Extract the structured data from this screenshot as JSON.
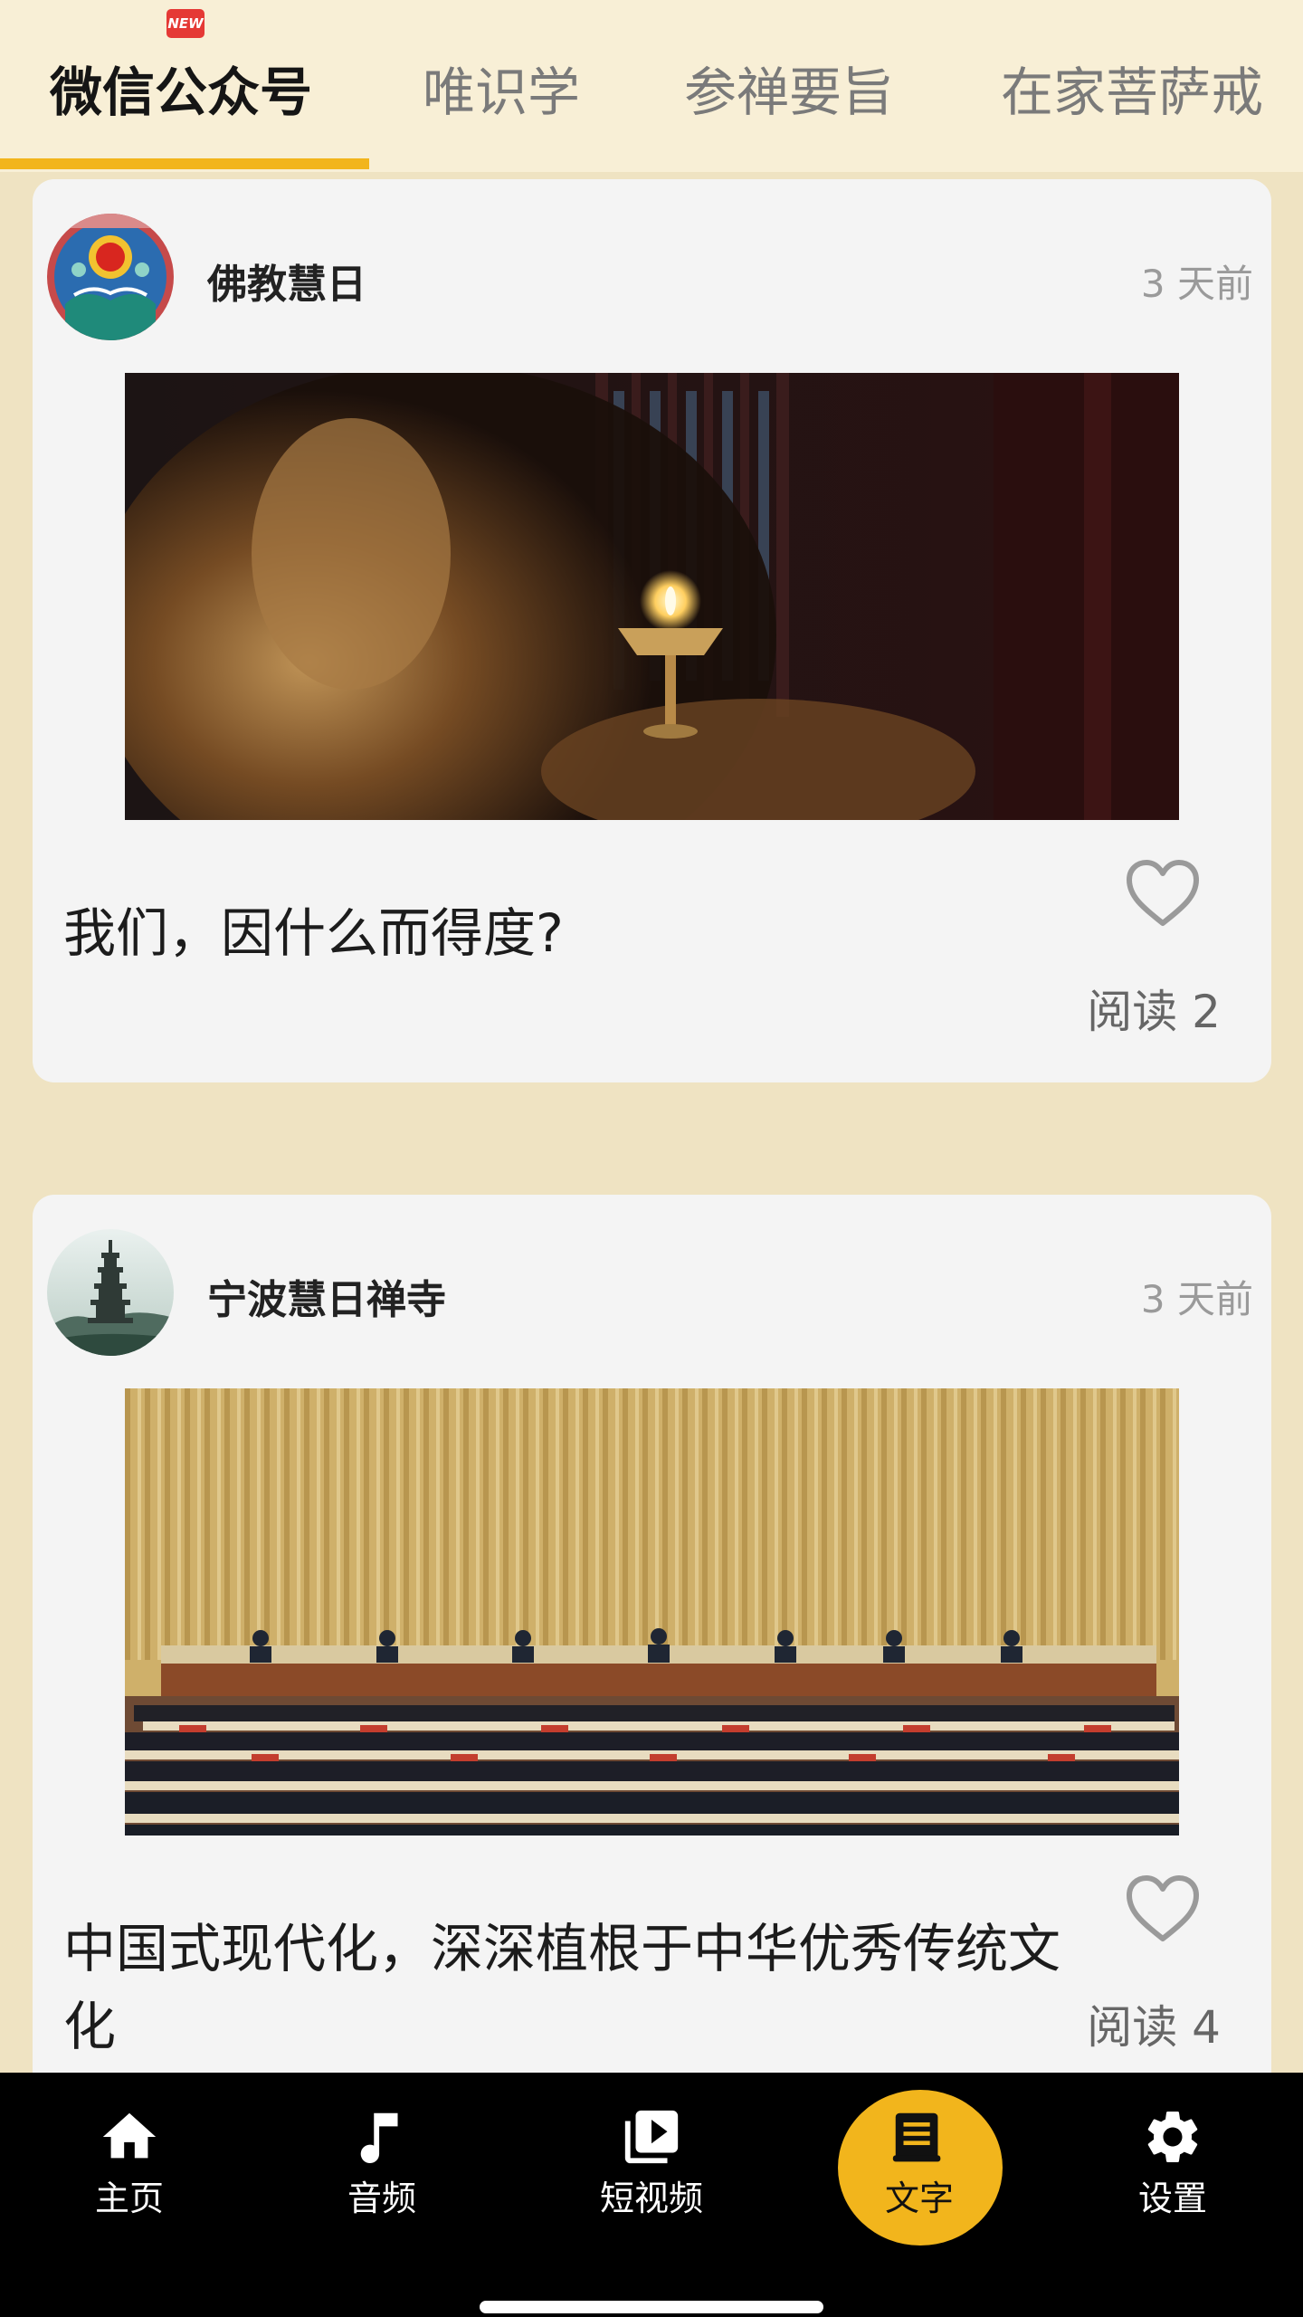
{
  "tabs": [
    {
      "label": "微信公众号",
      "active": true,
      "badge": "NEW"
    },
    {
      "label": "唯识学",
      "active": false
    },
    {
      "label": "参禅要旨",
      "active": false
    },
    {
      "label": "在家菩萨戒",
      "active": false
    }
  ],
  "posts": [
    {
      "author": "佛教慧日",
      "time": "3 天前",
      "title": "我们，因什么而得度?",
      "reads": "阅读 2",
      "avatar_icon": "buddhist-emblem-avatar",
      "image": "butter-lamp-photo"
    },
    {
      "author": "宁波慧日禅寺",
      "time": "3 天前",
      "title": "中国式现代化，深深植根于中华优秀传统文化",
      "reads": "阅读 4",
      "avatar_icon": "pagoda-avatar",
      "image": "conference-hall-photo"
    }
  ],
  "bottom_nav": [
    {
      "label": "主页",
      "icon": "home-icon"
    },
    {
      "label": "音频",
      "icon": "music-note-icon"
    },
    {
      "label": "短视频",
      "icon": "video-library-icon"
    },
    {
      "label": "文字",
      "icon": "article-icon",
      "active": true
    },
    {
      "label": "设置",
      "icon": "gear-icon"
    }
  ],
  "colors": {
    "accent": "#f2b51c",
    "background": "#efe3c2",
    "card": "#f4f4f4",
    "nav_background": "#000000"
  }
}
